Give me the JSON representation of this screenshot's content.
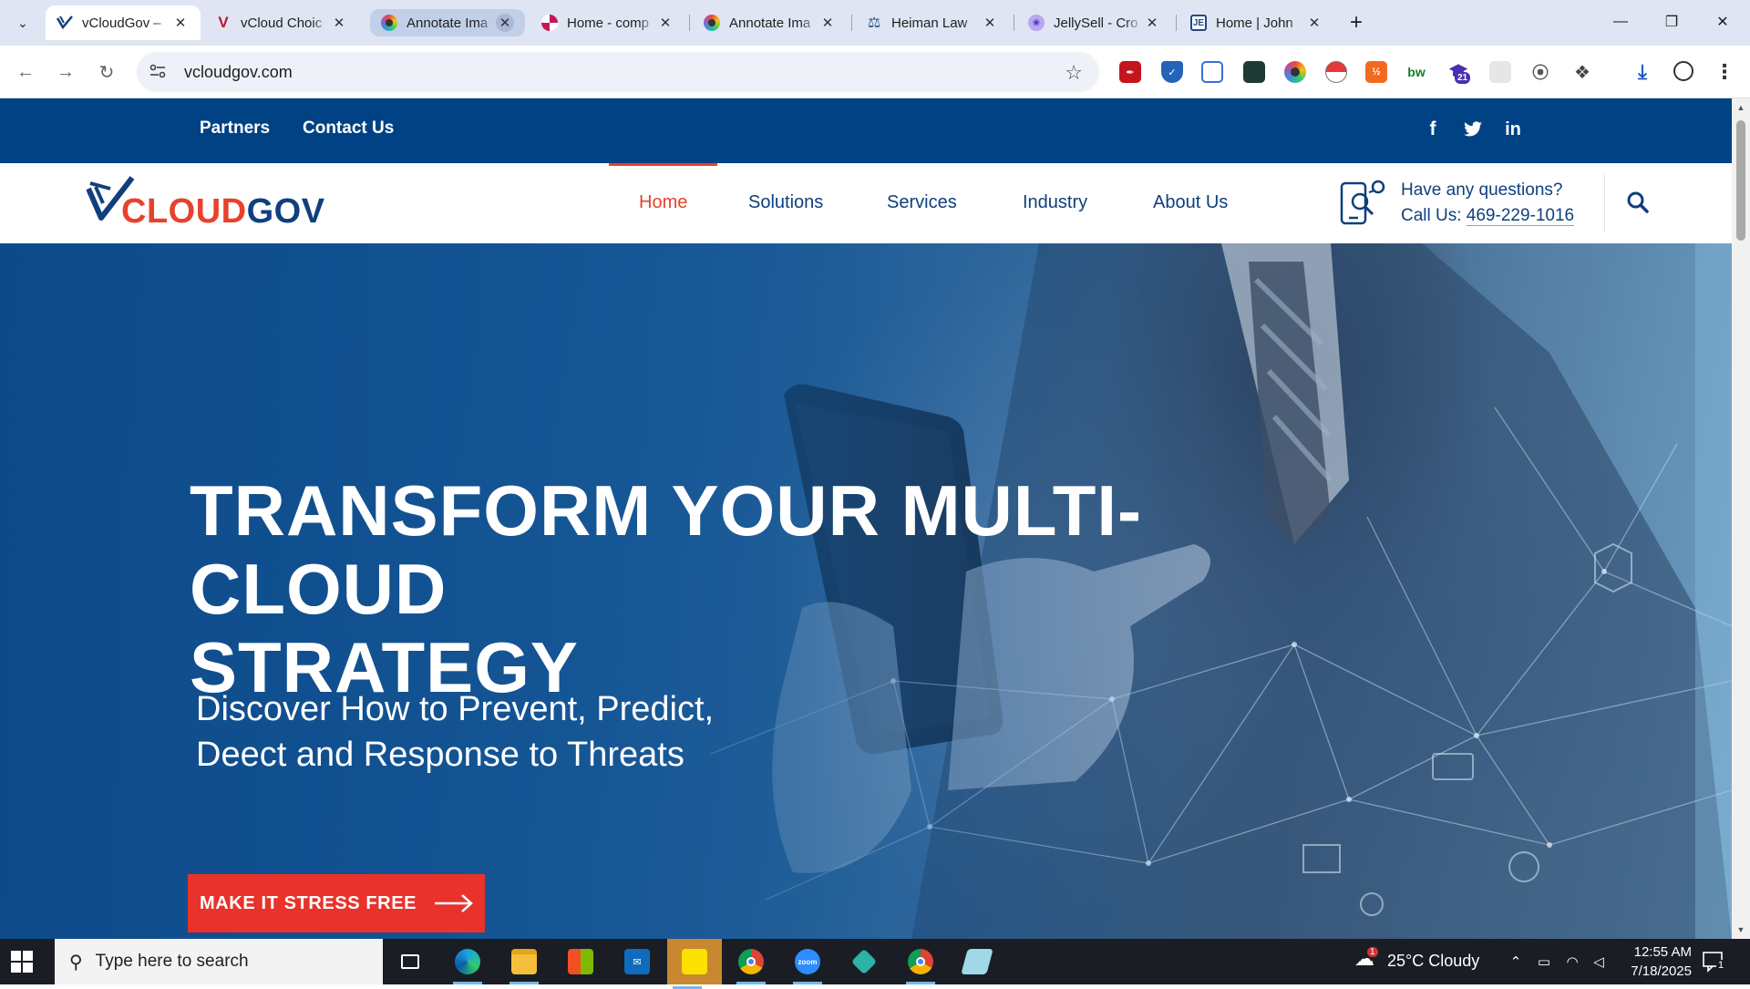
{
  "browser": {
    "tabs": [
      {
        "title": "vCloudGov –",
        "favicon": "vcloudgov-check-icon",
        "active": true
      },
      {
        "title": "vCloud Choic",
        "favicon": "v-logo-icon"
      },
      {
        "title": "Annotate Ima",
        "favicon": "annotate-icon",
        "highlighted": true
      },
      {
        "title": "Home - comp",
        "favicon": "pinwheel-icon"
      },
      {
        "title": "Annotate Ima",
        "favicon": "annotate-icon"
      },
      {
        "title": "Heiman Law",
        "favicon": "scales-icon"
      },
      {
        "title": "JellySell - Cro",
        "favicon": "jellyfish-icon"
      },
      {
        "title": "Home | John",
        "favicon": "doc-logo-icon"
      }
    ],
    "url": "vcloudgov.com",
    "extensions": [
      "acrobat-icon",
      "shield-icon",
      "clipboard-icon",
      "wallet-icon",
      "annotate-icon",
      "pokeball-icon",
      "half-orange-icon",
      "bw-icon",
      "graduation-cap-icon",
      "blank-icon",
      "compass-icon",
      "puzzle-icon"
    ],
    "extension_badge": "21",
    "extension_bw_label": "bw"
  },
  "site": {
    "topbar": {
      "links": [
        "Partners",
        "Contact Us"
      ],
      "social": [
        "f",
        "in"
      ]
    },
    "brand": {
      "part1": "CLOUD",
      "part2": "GOV"
    },
    "nav": [
      "Home",
      "Solutions",
      "Services",
      "Industry",
      "About Us"
    ],
    "active_nav": "Home",
    "contact": {
      "question": "Have any questions?",
      "call_prefix": "Call Us:",
      "phone": "469-229-1016"
    },
    "hero": {
      "headline_line1": "TRANSFORM YOUR MULTI-CLOUD",
      "headline_line2": "STRATEGY",
      "sub_line1": "Discover How to Prevent, Predict,",
      "sub_line2": "Deect and Response to Threats",
      "cta": "MAKE IT STRESS FREE"
    },
    "colors": {
      "brand_blue": "#004284",
      "accent_red": "#e8422d",
      "nav_text": "#0f3f7e"
    }
  },
  "taskbar": {
    "search_placeholder": "Type here to search",
    "weather": "25°C  Cloudy",
    "weather_badge": "1",
    "time": "12:55 AM",
    "date": "7/18/2025",
    "notification_count": "1"
  }
}
